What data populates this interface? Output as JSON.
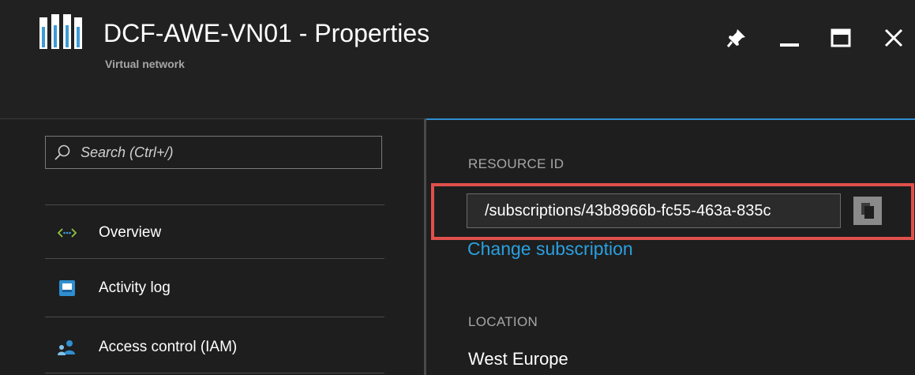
{
  "header": {
    "title": "DCF-AWE-VN01 - Properties",
    "subtitle": "Virtual network",
    "icons": [
      "virtual-network-icon",
      "pin-icon",
      "minimize-icon",
      "maximize-icon",
      "close-icon"
    ]
  },
  "sidebar": {
    "search": {
      "placeholder": "Search (Ctrl+/)",
      "value": ""
    },
    "items": [
      {
        "label": "Overview",
        "icon": "overview-icon"
      },
      {
        "label": "Activity log",
        "icon": "activity-log-icon"
      },
      {
        "label": "Access control (IAM)",
        "icon": "access-control-icon"
      }
    ]
  },
  "main": {
    "resource_id_label": "RESOURCE ID",
    "resource_id_value": "/subscriptions/43b8966b-fc55-463a-835c",
    "change_subscription_link": "Change subscription",
    "location_label": "LOCATION",
    "location_value": "West Europe"
  },
  "colors": {
    "accent": "#2f8fd0",
    "link": "#2aa0e0",
    "highlight": "#e0504c",
    "background": "#1e1e1e"
  }
}
